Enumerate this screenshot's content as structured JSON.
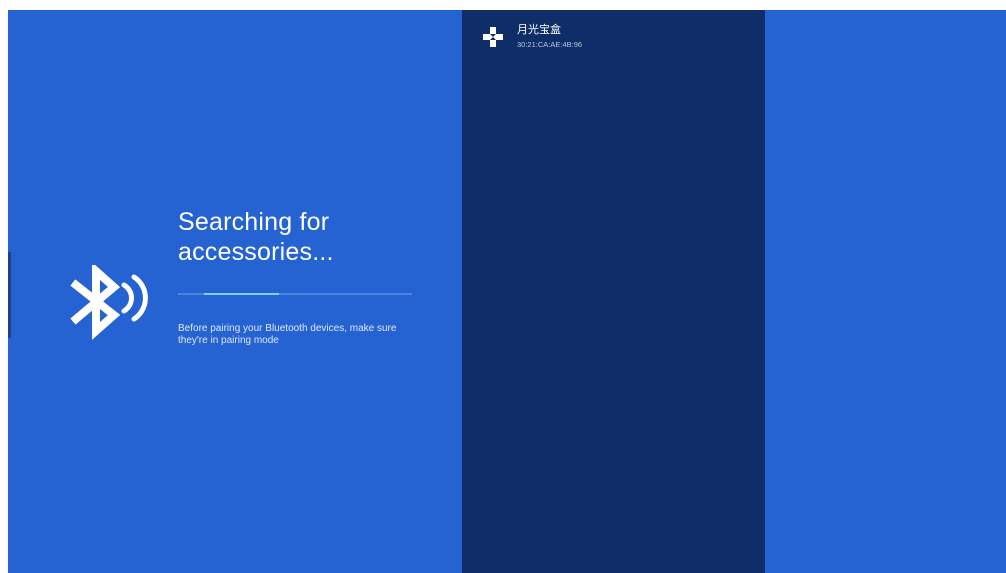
{
  "search": {
    "title_line1": "Searching for",
    "title_line2": "accessories...",
    "hint": "Before pairing your Bluetooth devices, make sure they're in pairing mode",
    "progress_fraction": 0.32,
    "icon": "bluetooth-searching-icon"
  },
  "devices": [
    {
      "name": "月光宝盒",
      "mac": "30:21:CA:AE:4B:96",
      "icon": "gamepad-icon"
    }
  ],
  "colors": {
    "background": "#2563d2",
    "panel": "#0f2d66",
    "progress_track": "#4f84de",
    "progress_fill": "#7fd3e8",
    "text": "#ffffff"
  }
}
